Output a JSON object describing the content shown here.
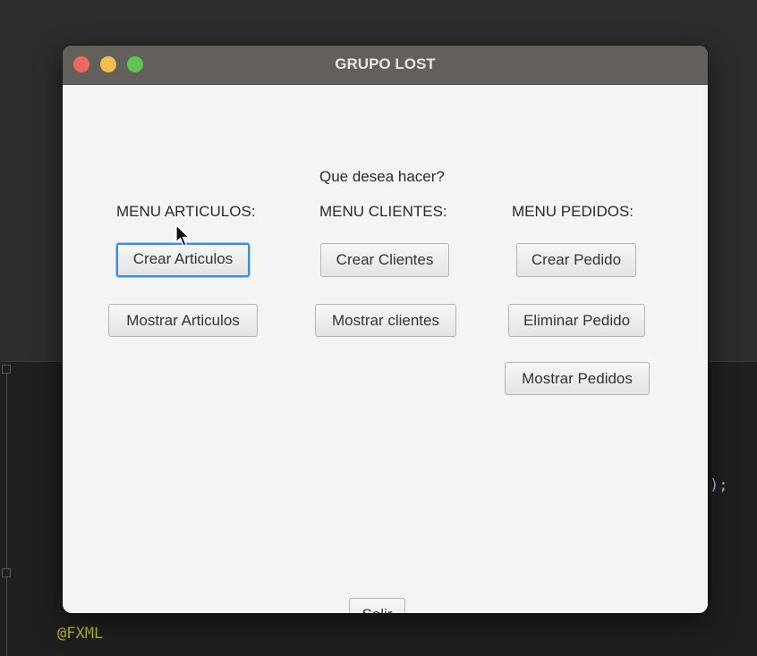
{
  "window": {
    "title": "GRUPO LOST"
  },
  "main": {
    "prompt": "Que desea hacer?",
    "sections": {
      "articulos": {
        "heading": "MENU ARTICULOS:",
        "create_label": "Crear Articulos",
        "list_label": "Mostrar Articulos"
      },
      "clientes": {
        "heading": "MENU CLIENTES:",
        "create_label": "Crear Clientes",
        "list_label": "Mostrar clientes"
      },
      "pedidos": {
        "heading": "MENU PEDIDOS:",
        "create_label": "Crear Pedido",
        "delete_label": "Eliminar Pedido",
        "list_label": "Mostrar Pedidos"
      }
    },
    "exit_label": "Salir"
  },
  "background_editor": {
    "annotation": "@FXML",
    "trailing_code": ");"
  },
  "colors": {
    "titlebar": "#635f5b",
    "window_bg": "#f4f4f4",
    "focus_ring": "#3a8fd6",
    "close": "#ed6a5e",
    "minimize": "#f4bf4f",
    "maximize": "#61c554"
  }
}
